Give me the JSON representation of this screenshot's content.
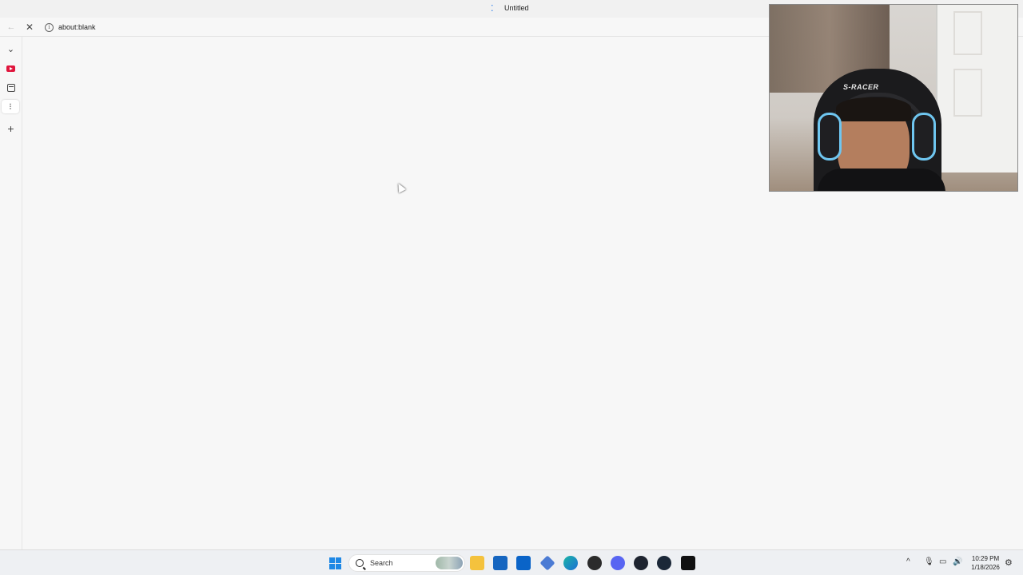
{
  "window": {
    "title": "Untitled"
  },
  "toolbar": {
    "address": "about:blank",
    "stop_glyph": "✕",
    "back_glyph": "←"
  },
  "sidebar": {
    "items": [
      {
        "name": "collapse-chevron",
        "glyph": "⌄"
      },
      {
        "name": "youtube-icon",
        "glyph": ""
      },
      {
        "name": "calendar-icon",
        "glyph": ""
      },
      {
        "name": "tab-active",
        "glyph": "⁝"
      },
      {
        "name": "add-tab",
        "glyph": "+"
      }
    ]
  },
  "webcam": {
    "chair_brand": "S-RACER"
  },
  "taskbar": {
    "search_placeholder": "Search",
    "clock_time": "10:29 PM",
    "clock_date": "1/18/2026",
    "tray_chevron": "^",
    "apps": [
      "file-explorer",
      "store",
      "outlook",
      "app-generic",
      "edge",
      "app-red",
      "discord",
      "app-dark",
      "steam",
      "call-of-duty"
    ]
  },
  "colors": {
    "accent": "#1a73e8",
    "youtube": "#e0163d",
    "webcam_ring": "#6fc6f0"
  }
}
